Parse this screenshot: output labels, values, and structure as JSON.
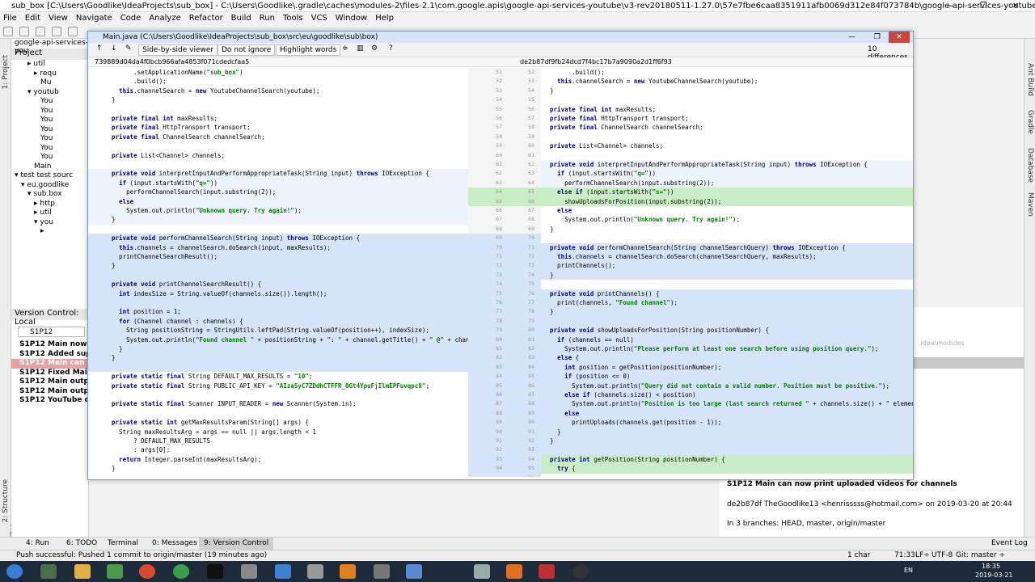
{
  "window": {
    "title": "sub_box [C:\\Users\\Goodlike\\IdeaProjects\\sub_box] - C:\\Users\\Goodlike\\.gradle\\caches\\modules-2\\files-2.1\\com.google.apis\\google-api-services-youtube\\v3-rev20180511-1.27.0\\57e7fbe6caa8351911afb0069d312e84f073784b\\google-api-services-youtube-v3-rev20180511-1",
    "controls": "— ❐ ✕"
  },
  "menu": [
    "File",
    "Edit",
    "View",
    "Navigate",
    "Code",
    "Analyze",
    "Refactor",
    "Build",
    "Run",
    "Tools",
    "VCS",
    "Window",
    "Help"
  ],
  "project": {
    "crumb": "google-api-services-you",
    "header": "Project",
    "tree": [
      {
        "t": "▸ util",
        "i": 34
      },
      {
        "t": "▸ requ",
        "i": 42
      },
      {
        "t": "",
        "i": 50
      },
      {
        "t": "",
        "i": 50
      },
      {
        "t": "Mu",
        "i": 50
      },
      {
        "t": "▾ youtub",
        "i": 34
      },
      {
        "t": "You",
        "i": 50
      },
      {
        "t": "You",
        "i": 50
      },
      {
        "t": "You",
        "i": 50
      },
      {
        "t": "You",
        "i": 50
      },
      {
        "t": "You",
        "i": 50
      },
      {
        "t": "You",
        "i": 50
      },
      {
        "t": "You",
        "i": 50
      },
      {
        "t": "Main",
        "i": 42
      },
      {
        "t": "▾ test  test sourc",
        "i": 18
      },
      {
        "t": "▾ eu.goodlike",
        "i": 26
      },
      {
        "t": "▾ sub.box",
        "i": 34
      },
      {
        "t": "▸ http",
        "i": 42
      },
      {
        "t": "▸ util",
        "i": 42
      },
      {
        "t": "▾ you",
        "i": 42
      },
      {
        "t": "▸",
        "i": 50
      }
    ]
  },
  "vc": {
    "header": "Version Control:",
    "tab": "Local",
    "search": "S1P12",
    "commits": [
      {
        "t": "S1P12 Main now suppo",
        "sel": false
      },
      {
        "t": "S1P12 Added support",
        "sel": false
      },
      {
        "t": "S1P12 Main can now p",
        "sel": true
      },
      {
        "t": "S1P12 Fixed Main sear",
        "sel": false
      },
      {
        "t": "S1P12 Main output im",
        "sel": false
      },
      {
        "t": "S1P12 Main output im",
        "sel": false
      },
      {
        "t": "S1P12 YouTube chann",
        "sel": false
      }
    ]
  },
  "dialog": {
    "title": "Main.java (C:\\Users\\Goodlike\\IdeaProjects\\sub_box\\src\\eu\\goodlike\\sub\\box)",
    "controls": "— ❐",
    "close": "✕",
    "viewer": "Side-by-side viewer",
    "ignore": "Do not ignore",
    "highlight": "Highlight words",
    "diffcount": "10 differences",
    "left_hash": "739889d04da4f0bcb966afa4853f071cdedcfaa5",
    "right_hash": "de2b87df9fb24dcd7f4bc17b7a9090a2d1ff6f93"
  },
  "left_lines": [
    "        .setApplicationName(\"sub_box\")",
    "        .build();",
    "    this.channelSearch = new YoutubeChannelSearch(youtube);",
    "  }",
    "",
    "  private final int maxResults;",
    "  private final HttpTransport transport;",
    "  private final ChannelSearch channelSearch;",
    "",
    "  private List<Channel> channels;",
    "",
    "  private void interpretInputAndPerformAppropriateTask(String input) throws IOException {",
    "    if (input.startsWith(\"q=\"))",
    "      performChannelSearch(input.substring(2));",
    "    else",
    "      System.out.println(\"Unknown query. Try again!\");",
    "  }",
    "",
    "  private void performChannelSearch(String input) throws IOException {",
    "    this.channels = channelSearch.doSearch(input, maxResults);",
    "    printChannelSearchResult();",
    "  }",
    "",
    "  private void printChannelSearchResult() {",
    "    int indexSize = String.valueOf(channels.size()).length();",
    "",
    "    int position = 1;",
    "    for (Channel channel : channels) {",
    "      String positionString = StringUtils.leftPad(String.valueOf(position++), indexSize);",
    "      System.out.println(\"Found channel \" + positionString + \": \" + channel.getTitle() + \" @\" + channel.getU",
    "    }",
    "  }",
    "",
    "  private static final String DEFAULT_MAX_RESULTS = \"10\";",
    "  private static final String PUBLIC_API_KEY = \"AIzaSyC7ZDdhCTFFR_0Gt4YpuFjIlmEPFuvqpc8\";",
    "",
    "  private static final Scanner INPUT_READER = new Scanner(System.in);",
    "",
    "  private static int getMaxResultsParam(String[] args) {",
    "    String maxResultsArg = args == null || args.length < 1",
    "        ? DEFAULT_MAX_RESULTS",
    "        : args[0];",
    "    return Integer.parseInt(maxResultsArg);",
    "  }"
  ],
  "right_lines": [
    "        .build();",
    "    this.channelSearch = new YoutubeChannelSearch(youtube);",
    "  }",
    "",
    "  private final int maxResults;",
    "  private final HttpTransport transport;",
    "  private final ChannelSearch channelSearch;",
    "",
    "  private List<Channel> channels;",
    "",
    "  private void interpretInputAndPerformAppropriateTask(String input) throws IOException {",
    "    if (input.startsWith(\"q=\"))",
    "      performChannelSearch(input.substring(2));",
    "    else if (input.startsWith(\"s=\"))",
    "      showUploadsForPosition(input.substring(2));",
    "    else",
    "      System.out.println(\"Unknown query. Try again!\");",
    "  }",
    "",
    "  private void performChannelSearch(String channelSearchQuery) throws IOException {",
    "    this.channels = channelSearch.doSearch(channelSearchQuery, maxResults);",
    "    printChannels();",
    "  }",
    "",
    "  private void printChannels() {",
    "    print(channels, \"Found channel\");",
    "  }",
    "",
    "  private void showUploadsForPosition(String positionNumber) {",
    "    if (channels == null)",
    "      System.out.println(\"Please perform at least one search before using position query.\");",
    "    else {",
    "      int position = getPosition(positionNumber);",
    "      if (position <= 0)",
    "        System.out.println(\"Query did not contain a valid number. Position must be positive.\");",
    "      else if (channels.size() < position)",
    "        System.out.println(\"Position is too large (last search returned \" + channels.size() + \" elements)",
    "      else",
    "        printUploads(channels.get(position - 1));",
    "    }",
    "  }",
    "",
    "  private int getPosition(String positionNumber) {",
    "    try {"
  ],
  "left_nums": [
    "",
    "",
    "",
    "",
    "",
    "",
    "",
    "",
    "",
    "",
    "",
    "",
    "",
    "",
    "",
    "",
    "",
    "",
    "",
    "",
    "",
    "",
    "",
    "",
    "",
    "",
    "",
    "",
    "",
    "",
    "",
    "",
    "",
    "",
    "",
    "",
    "",
    "",
    "",
    "",
    "",
    "",
    "",
    "",
    ""
  ],
  "gutter_left": [
    "51",
    "52",
    "53",
    "54",
    "55",
    "56",
    "57",
    "58",
    "59",
    "60",
    "61",
    "62",
    "63",
    "64",
    "65",
    "66",
    "67",
    "68",
    "69",
    "70",
    "71",
    "72",
    "73",
    "74",
    "75",
    "76",
    "77",
    "78",
    "79",
    "80",
    "81",
    "82",
    "83",
    "84",
    "85",
    "86",
    "87",
    "88",
    "89",
    "90",
    "91",
    "92",
    "93",
    "94"
  ],
  "gutter_right": [
    "52",
    "53",
    "54",
    "55",
    "56",
    "57",
    "58",
    "59",
    "60",
    "61",
    "62",
    "63",
    "64",
    "65",
    "66",
    "67",
    "68",
    "69",
    "70",
    "71",
    "72",
    "73",
    "74",
    "75",
    "76",
    "77",
    "78",
    "79",
    "80",
    "81",
    "82",
    "83",
    "84",
    "85",
    "86",
    "87",
    "88",
    "89",
    "90",
    "91",
    "92",
    "93",
    "94",
    "95",
    "96",
    "97",
    "98",
    "99",
    "100",
    "101"
  ],
  "details": {
    "subject": "S1P12 Main can now print uploaded videos for channels",
    "meta": "de2b87df TheGoodlike13 <henrisssss@hotmail.com> on 2019-03-20 at 20:44",
    "branches": "In 3 branches: HEAD, master, origin/master",
    "path": ".idea\\modules"
  },
  "bottom_tabs": [
    "4: Run",
    "6: TODO",
    "Terminal",
    "0: Messages",
    "9: Version Control"
  ],
  "event_log": "Event Log",
  "status": {
    "message": "Push successful: Pushed 1 commit to origin/master (19 minutes ago)",
    "chars": "1 char",
    "pos": "71:33",
    "crlf": "LF÷",
    "enc": "UTF-8",
    "git": "Git: master ÷"
  },
  "left_tabs": [
    "1: Project",
    "2: Structure",
    "2: Favorites"
  ],
  "right_tabs": [
    "Ant Build",
    "Gradle",
    "Database",
    "Maven"
  ],
  "tray": {
    "lang": "EN",
    "time": "18:35",
    "date": "2019-03-21"
  },
  "colors": {
    "changed": "#d6e4f9",
    "inserted": "#c9eec5",
    "dialog_border": "#7a9cc6"
  }
}
